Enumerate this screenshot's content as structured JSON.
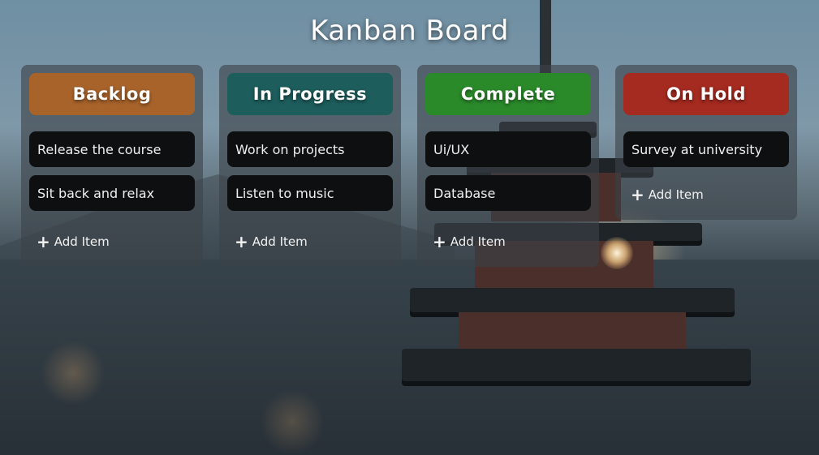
{
  "board": {
    "title": "Kanban Board",
    "add_label": "Add Item",
    "columns": [
      {
        "name": "Backlog",
        "color": "#a8632b",
        "items": [
          "Release the course",
          "Sit back and relax"
        ]
      },
      {
        "name": "In Progress",
        "color": "#1d5d5c",
        "items": [
          "Work on projects",
          "Listen to music"
        ]
      },
      {
        "name": "Complete",
        "color": "#2a8a2a",
        "items": [
          "Ui/UX",
          "Database"
        ]
      },
      {
        "name": "On Hold",
        "color": "#a52a20",
        "items": [
          "Survey at university"
        ]
      }
    ]
  },
  "icons": {
    "add": "plus-icon"
  }
}
